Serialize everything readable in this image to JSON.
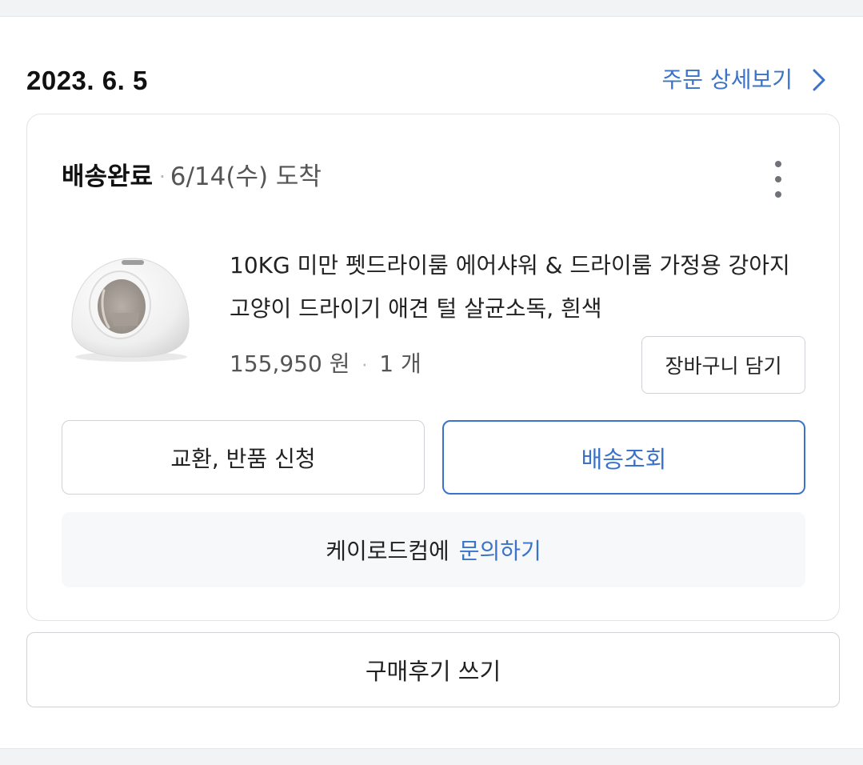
{
  "order": {
    "date": "2023. 6. 5",
    "detail_link_label": "주문 상세보기"
  },
  "shipment": {
    "status": "배송완료",
    "separator": "·",
    "arrival": "6/14(수) 도착"
  },
  "product": {
    "name": "10KG 미만 펫드라이룸 에어샤워 & 드라이룸 가정용 강아지 고양이 드라이기 애견 털 살균소독, 흰색",
    "price": "155,950 원",
    "separator": "·",
    "quantity": "1 개",
    "cart_button_label": "장바구니 담기"
  },
  "actions": {
    "exchange_label": "교환, 반품 신청",
    "tracking_label": "배송조회"
  },
  "inquiry": {
    "seller_text": "케이로드컴에",
    "link_label": "문의하기"
  },
  "review": {
    "button_label": "구매후기 쓰기"
  },
  "colors": {
    "accent_blue": "#3a73c9",
    "text_primary": "#222222",
    "text_secondary": "#555555",
    "border": "#cfd2d7",
    "inquiry_background": "#f7f8f9",
    "page_background": "#f2f3f5"
  },
  "icons": {
    "detail_chevron": "chevron-right-icon",
    "more_menu": "more-vertical-icon"
  }
}
